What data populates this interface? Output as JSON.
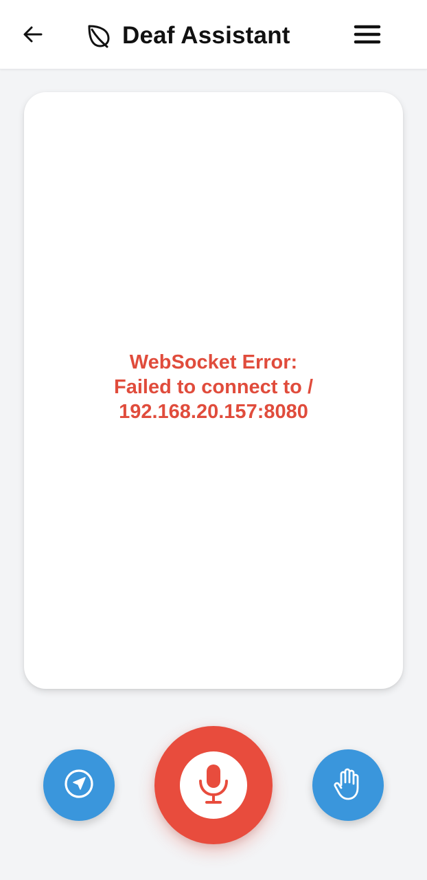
{
  "header": {
    "back_icon": "arrow-left-icon",
    "logo_icon": "leaf-icon",
    "title": "Deaf Assistant",
    "menu_icon": "hamburger-menu-icon"
  },
  "main": {
    "error_message": "WebSocket Error:\nFailed to connect to /\n192.168.20.157:8080",
    "error_color": "#e04c3c"
  },
  "actions": {
    "navigation": {
      "icon": "navigation-arrow-icon",
      "color": "#3a96dc"
    },
    "microphone": {
      "icon": "microphone-icon",
      "color": "#e84c3d"
    },
    "hand": {
      "icon": "raised-hand-icon",
      "color": "#3a96dc"
    }
  }
}
